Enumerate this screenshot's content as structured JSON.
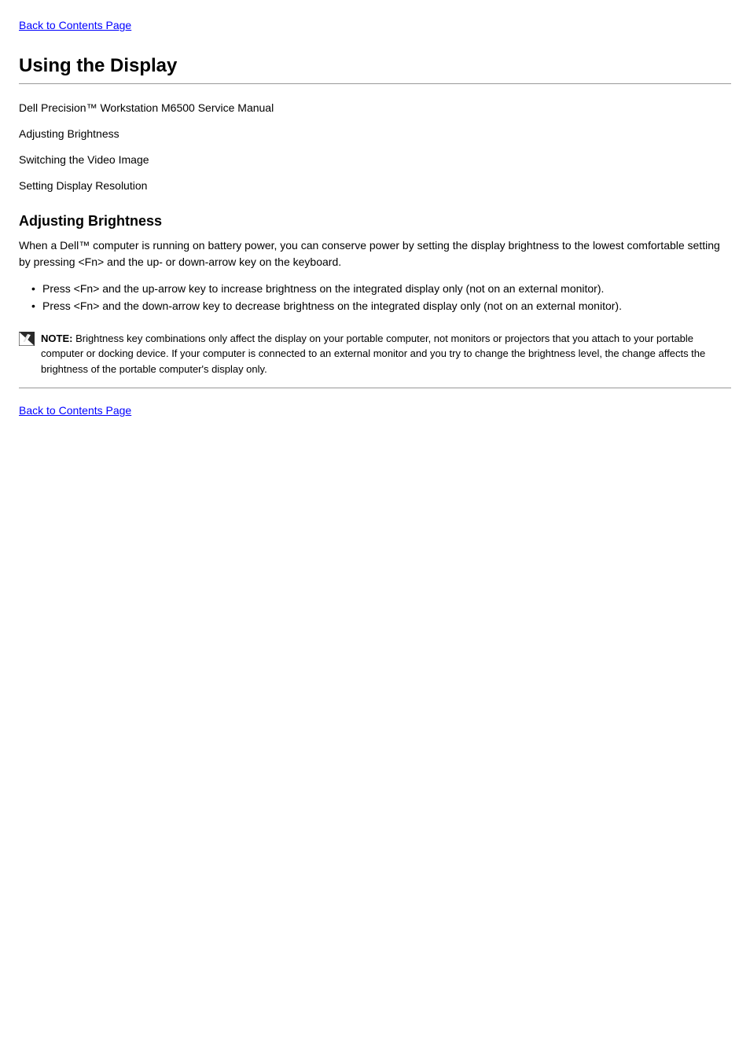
{
  "top_link": "Back to Contents Page",
  "section1": {
    "title": "Using the Display",
    "line1": "Dell Precision™ Workstation M6500 Service Manual",
    "line2": "Adjusting Brightness",
    "line3": "Switching the Video Image",
    "line4": "Setting Display Resolution"
  },
  "section2": {
    "title": "Adjusting Brightness",
    "paragraph": "When a Dell™ computer is running on battery power, you can conserve power by setting the display brightness to the lowest comfortable setting by pressing <Fn> and the up- or down-arrow key on the keyboard.",
    "list": [
      "Press <Fn> and the up-arrow key to increase brightness on the integrated display only (not on an external monitor).",
      "Press <Fn> and the down-arrow key to decrease brightness on the integrated display only (not on an external monitor)."
    ]
  },
  "note": {
    "label": "NOTE:",
    "text": " Brightness key combinations only affect the display on your portable computer, not monitors or projectors that you attach to your portable computer or docking device. If your computer is connected to an external monitor and you try to change the brightness level, the change affects the brightness of the portable computer's display only."
  },
  "bottom_link": "Back to Contents Page"
}
